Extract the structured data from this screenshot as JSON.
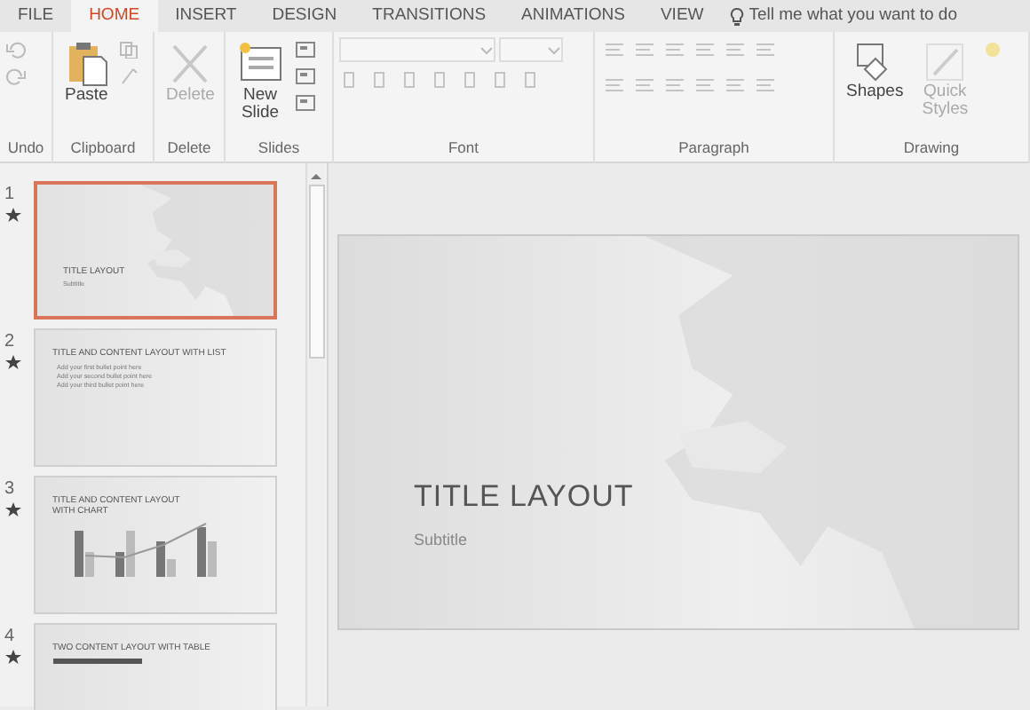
{
  "menu_tabs": [
    {
      "label": "FILE",
      "selected": false
    },
    {
      "label": "HOME",
      "selected": true
    },
    {
      "label": "INSERT",
      "selected": false
    },
    {
      "label": "DESIGN",
      "selected": false
    },
    {
      "label": "TRANSITIONS",
      "selected": false
    },
    {
      "label": "ANIMATIONS",
      "selected": false
    },
    {
      "label": "VIEW",
      "selected": false
    }
  ],
  "tell_me": "Tell me what you want to do",
  "ribbon_groups": [
    {
      "label": "Undo",
      "kind": "undo"
    },
    {
      "label": "Clipboard",
      "kind": "clipboard",
      "button": {
        "label": "Paste",
        "disabled": false
      }
    },
    {
      "label": "Delete",
      "kind": "delete",
      "button": {
        "label": "Delete",
        "disabled": true
      }
    },
    {
      "label": "Slides",
      "kind": "slides",
      "button": {
        "label": "New Slide",
        "disabled": false
      }
    },
    {
      "label": "Font",
      "kind": "font"
    },
    {
      "label": "Paragraph",
      "kind": "paragraph"
    },
    {
      "label": "Drawing",
      "kind": "drawing",
      "buttons": [
        {
          "label": "Shapes",
          "disabled": false
        },
        {
          "label": "Quick Styles",
          "disabled": true
        }
      ]
    }
  ],
  "slides": [
    {
      "number": "1",
      "kind": "title",
      "selected": true,
      "title": "TITLE LAYOUT",
      "subtitle": "Subtitle"
    },
    {
      "number": "2",
      "kind": "list",
      "selected": false,
      "title": "TITLE AND CONTENT LAYOUT WITH LIST",
      "bullets": [
        "Add your first bullet point here",
        "Add your second bullet point here",
        "Add your third bullet point here"
      ]
    },
    {
      "number": "3",
      "kind": "chart",
      "selected": false,
      "title": "TITLE AND CONTENT LAYOUT WITH CHART"
    },
    {
      "number": "4",
      "kind": "table",
      "selected": false,
      "title": "TWO CONTENT LAYOUT WITH TABLE"
    }
  ],
  "current_slide": {
    "title": "TITLE LAYOUT",
    "subtitle": "Subtitle"
  }
}
